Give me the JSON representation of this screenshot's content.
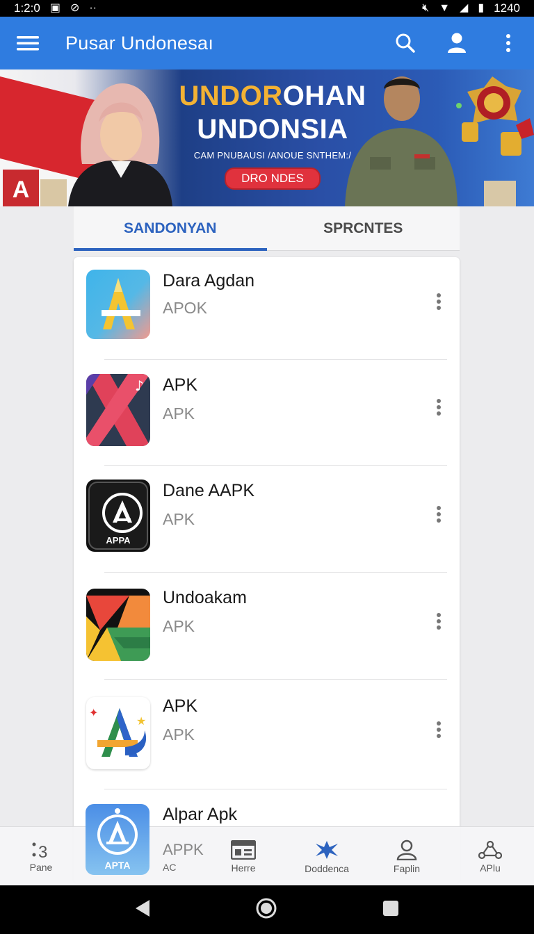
{
  "status_bar": {
    "time": "1:2:0",
    "battery": "1240"
  },
  "app_bar": {
    "title": "Pusar Undonesaı"
  },
  "banner": {
    "headline_gold": "UNDOR",
    "headline_white": "OHAN",
    "headline_2": "UNDONSIA",
    "subtitle": "CAM PNUBAUSI /ANOUE SNTHEM:/",
    "button_label": "DRO NDES"
  },
  "tabs": [
    {
      "label": "SANDONYAN",
      "active": true
    },
    {
      "label": "SPRCNTES",
      "active": false
    }
  ],
  "apps": [
    {
      "name": "Dara Agdan",
      "type": "APOK"
    },
    {
      "name": "APK",
      "type": "APK"
    },
    {
      "name": "Dane AAPK",
      "type": "APK",
      "icon_text": "APPA"
    },
    {
      "name": "Undoakam",
      "type": "APK"
    },
    {
      "name": "APK",
      "type": "APK"
    },
    {
      "name": "Alpar Apk",
      "type": ""
    }
  ],
  "bottom_nav": {
    "overlay_icon_text": "APTA",
    "items": [
      {
        "label": "Pane",
        "icon": "dots-icon"
      },
      {
        "label": "AC",
        "top": "APPK"
      },
      {
        "label": "Herre",
        "icon": "id-card-icon"
      },
      {
        "label": "Doddenca",
        "icon": "star-burst-icon"
      },
      {
        "label": "Faplin",
        "icon": "person-icon"
      },
      {
        "label": "APlu",
        "icon": "share-icon"
      }
    ]
  },
  "colors": {
    "primary": "#2f7ce0",
    "tab_active": "#2d63bf",
    "banner_button": "#e0323d"
  }
}
